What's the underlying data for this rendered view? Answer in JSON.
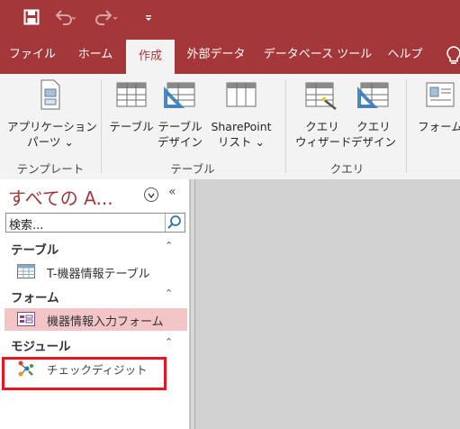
{
  "tabs": [
    "ファイル",
    "ホーム",
    "作成",
    "外部データ",
    "データベース ツール",
    "ヘルプ"
  ],
  "active_tab": "作成",
  "ribbon": {
    "templates": {
      "app_parts": "アプリケーション\nパーツ ⌄",
      "group": "テンプレート"
    },
    "tables": {
      "table": "テーブル",
      "table_design": "テーブル\nデザイン",
      "sharepoint": "SharePoint\nリスト ⌄",
      "group": "テーブル"
    },
    "queries": {
      "wizard": "クエリ\nウィザード",
      "design": "クエリ\nデザイン",
      "group": "クエリ"
    },
    "forms": {
      "form": "フォーム"
    }
  },
  "nav": {
    "title": "すべての A...",
    "search_placeholder": "検索...",
    "categories": [
      {
        "label": "テーブル",
        "items": [
          "T-機器情報テーブル"
        ]
      },
      {
        "label": "フォーム",
        "items": [
          "機器情報入力フォーム"
        ]
      },
      {
        "label": "モジュール",
        "items": [
          "チェックディジット"
        ]
      }
    ]
  },
  "colors": {
    "accent": "#a4373a",
    "selected": "#f4c5c7",
    "highlight_box": "#e8141f"
  }
}
